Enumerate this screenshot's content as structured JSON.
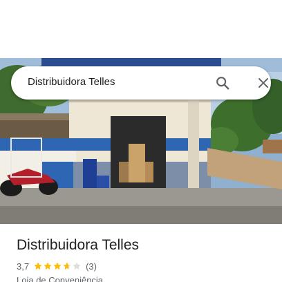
{
  "search": {
    "query": "Distribuidora Telles"
  },
  "place": {
    "name": "Distribuidora Telles",
    "rating_text": "3,7",
    "rating_value": 3.7,
    "rating_max": 5,
    "review_count_text": "(3)",
    "category": "Loja de Conveniência"
  },
  "icons": {
    "search": "search-icon",
    "close": "close-icon",
    "star": "star-icon"
  },
  "colors": {
    "star_fill": "#fbbc04",
    "star_empty": "#dadce0",
    "icon_gray": "#5f6368",
    "text_primary": "#202124",
    "text_secondary": "#5f6368"
  }
}
